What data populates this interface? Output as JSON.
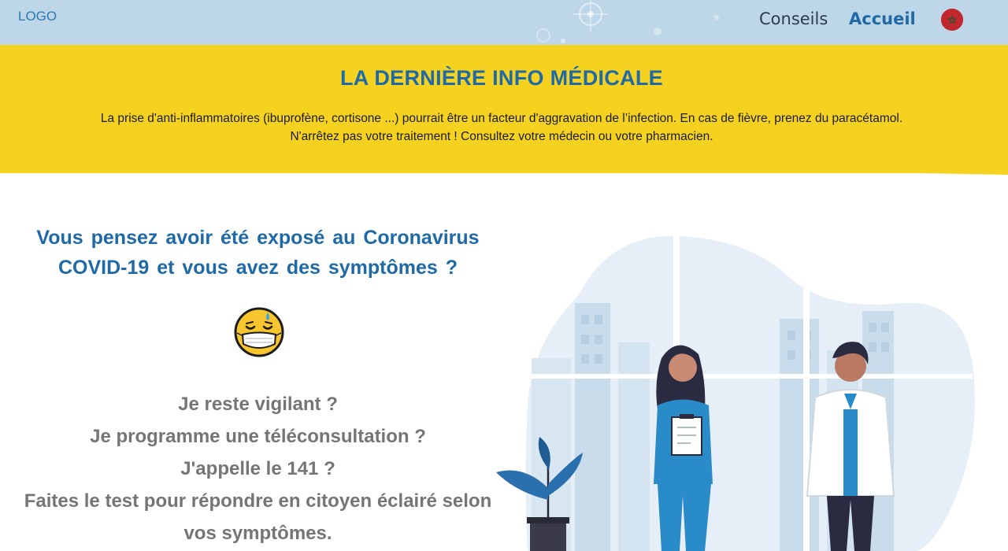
{
  "header": {
    "logo": "LOGO",
    "nav": [
      {
        "label": "Conseils"
      },
      {
        "label": "Accueil",
        "active": true
      }
    ],
    "language_flag": "morocco-flag-icon"
  },
  "banner": {
    "title": "LA DERNIÈRE INFO MÉDICALE",
    "lines": [
      "La prise d'anti-inflammatoires (ibuprofène, cortisone ...) pourrait être un facteur d'aggravation de l’infection. En cas de fièvre, prenez du paracétamol.",
      "N'arrêtez pas votre traitement ! Consultez votre médecin ou votre pharmacien."
    ]
  },
  "main": {
    "question_lines": [
      "Vous pensez avoir été exposé au Coronavirus",
      "COVID-19 et vous avez des symptômes ?"
    ],
    "emoji": "face-with-mask-icon",
    "options": [
      "Je reste vigilant ?",
      "Je programme une téléconsultation ?",
      "J'appelle le 141 ?",
      "Faites le test pour répondre en citoyen éclairé selon",
      "vos symptômes."
    ]
  },
  "colors": {
    "brand_blue": "#1f6aa6",
    "banner_yellow": "#f5d21f",
    "header_bg": "#bfd8e8",
    "muted_text": "#757575"
  }
}
